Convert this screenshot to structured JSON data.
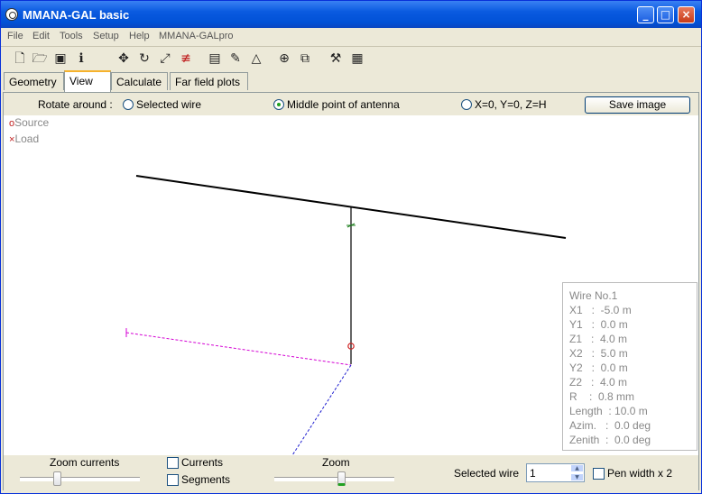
{
  "window": {
    "title": "MMANA-GAL basic"
  },
  "menu": {
    "items": [
      "File",
      "Edit",
      "Tools",
      "Setup",
      "Help",
      "MMANA-GALpro"
    ]
  },
  "toolbar": {
    "icons": [
      "new-file-icon",
      "open-folder-icon",
      "save-disk-icon",
      "info-icon",
      "move-icon",
      "rotate-icon",
      "scale-icon",
      "wire-split-icon",
      "page-icon",
      "pencil-icon",
      "triangle-icon",
      "crosshair-icon",
      "copy-icon",
      "tools-icon",
      "calculator-icon"
    ]
  },
  "tabs": [
    {
      "label": "Geometry",
      "active": false
    },
    {
      "label": "View",
      "active": true
    },
    {
      "label": "Calculate",
      "active": false
    },
    {
      "label": "Far field plots",
      "active": false
    }
  ],
  "rotate": {
    "label": "Rotate around :",
    "options": [
      "Selected wire",
      "Middle point of antenna",
      "X=0, Y=0, Z=H"
    ],
    "selected": "Middle point of antenna"
  },
  "save_image_label": "Save image",
  "legend": {
    "source": "Source",
    "load": "Load",
    "source_mark": "o",
    "load_mark": "×"
  },
  "wire_info": {
    "title": "Wire No.1",
    "rows": [
      "X1   :  -5.0 m",
      "Y1   :  0.0 m",
      "Z1   :  4.0 m",
      "X2   :  5.0 m",
      "Y2   :  0.0 m",
      "Z2   :  4.0 m",
      "R    :  0.8 mm",
      "Length  : 10.0 m",
      "Azim.   :  0.0 deg",
      "Zenith  :  0.0 deg"
    ]
  },
  "bottom": {
    "zoom_currents_label": "Zoom currents",
    "currents_label": "Currents",
    "segments_label": "Segments",
    "zoom_label": "Zoom",
    "selected_wire_label": "Selected wire",
    "selected_wire_value": "1",
    "pen_width_label": "Pen width x 2",
    "currents_checked": false,
    "segments_checked": false,
    "pen_width_checked": false
  },
  "colors": {
    "antenna": "#000000",
    "x_axis": "#d400d4",
    "y_axis": "#2020d0",
    "source": "#d02020"
  }
}
